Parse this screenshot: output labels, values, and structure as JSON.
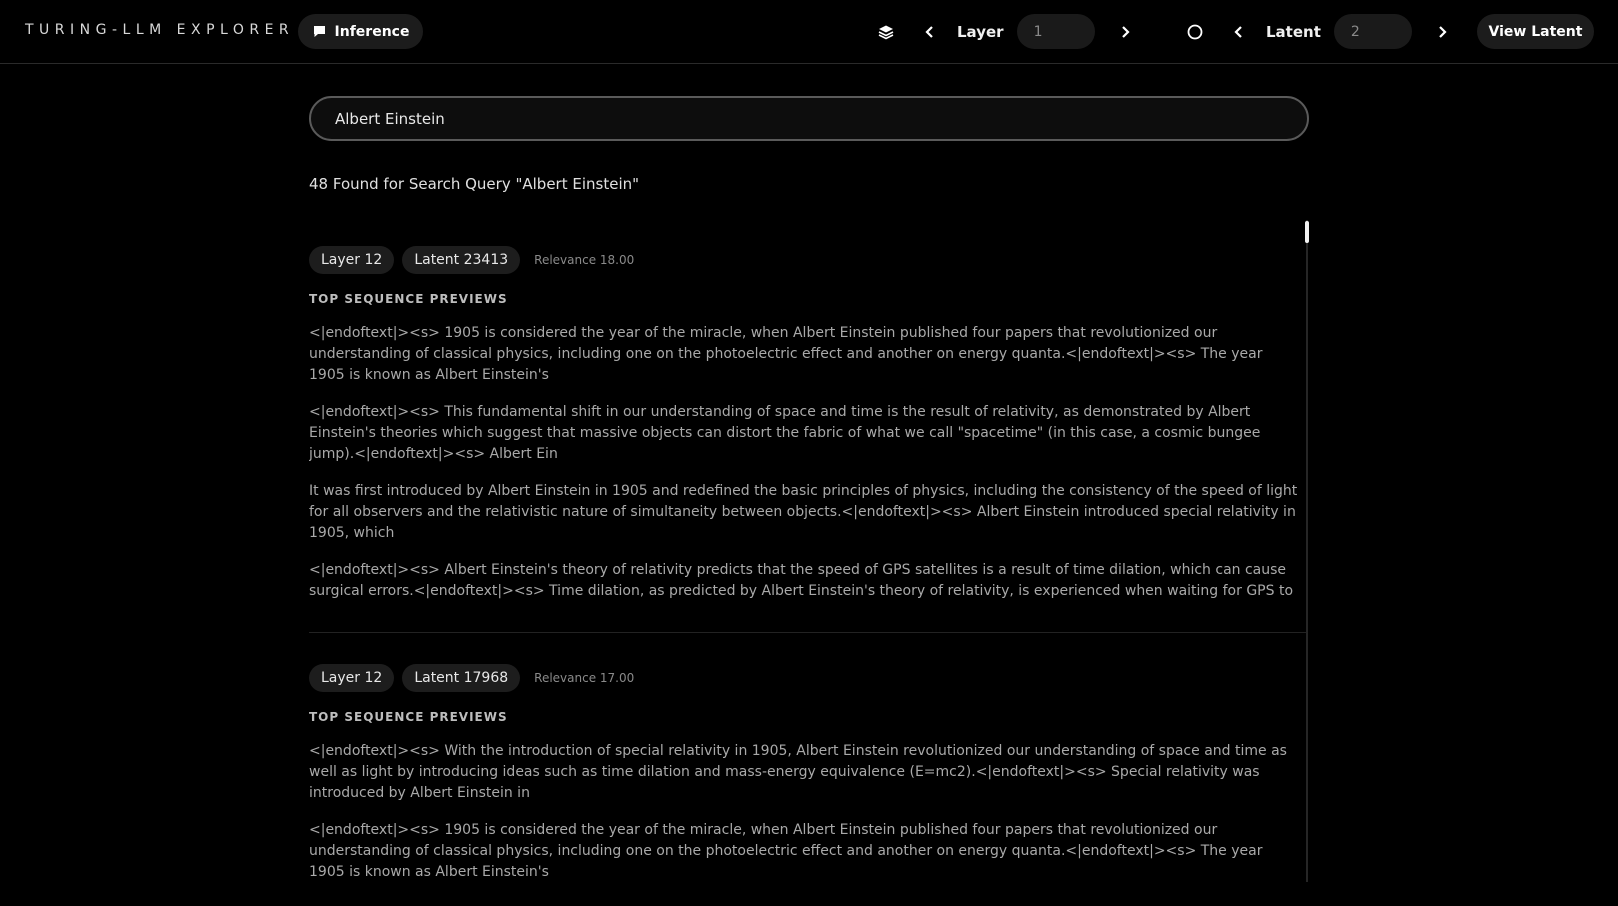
{
  "header": {
    "brand": "TURING-LLM EXPLORER",
    "inference_label": "Inference",
    "layer_label": "Layer",
    "layer_value": "1",
    "latent_label": "Latent",
    "latent_value": "2",
    "view_latent_label": "View Latent"
  },
  "search": {
    "value": "Albert Einstein",
    "result_summary": "48 Found for Search Query \"Albert Einstein\""
  },
  "results": [
    {
      "layer": "Layer 12",
      "latent": "Latent 23413",
      "relevance": "Relevance 18.00",
      "section_title": "TOP SEQUENCE PREVIEWS",
      "sequences": [
        "<|endoftext|><s> 1905 is considered the year of the miracle, when Albert Einstein published four papers that revolutionized our understanding of classical physics, including one on the photoelectric effect and another on energy quanta.<|endoftext|><s> The year 1905 is known as Albert Einstein's",
        "<|endoftext|><s> This fundamental shift in our understanding of space and time is the result of relativity, as demonstrated by Albert Einstein's theories which suggest that massive objects can distort the fabric of what we call \"spacetime\" (in this case, a cosmic bungee jump).<|endoftext|><s> Albert Ein",
        "It was first introduced by Albert Einstein in 1905 and redefined the basic principles of physics, including the consistency of the speed of light for all observers and the relativistic nature of simultaneity between objects.<|endoftext|><s> Albert Einstein introduced special relativity in 1905, which",
        "<|endoftext|><s> Albert Einstein's theory of relativity predicts that the speed of GPS satellites is a result of time dilation, which can cause surgical errors.<|endoftext|><s> Time dilation, as predicted by Albert Einstein's theory of relativity, is experienced when waiting for GPS to"
      ]
    },
    {
      "layer": "Layer 12",
      "latent": "Latent 17968",
      "relevance": "Relevance 17.00",
      "section_title": "TOP SEQUENCE PREVIEWS",
      "sequences": [
        "<|endoftext|><s> With the introduction of special relativity in 1905, Albert Einstein revolutionized our understanding of space and time as well as light by introducing ideas such as time dilation and mass-energy equivalence (E=mc2).<|endoftext|><s> Special relativity was introduced by Albert Einstein in",
        "<|endoftext|><s> 1905 is considered the year of the miracle, when Albert Einstein published four papers that revolutionized our understanding of classical physics, including one on the photoelectric effect and another on energy quanta.<|endoftext|><s> The year 1905 is known as Albert Einstein's"
      ]
    }
  ],
  "icons": {
    "inference": "message-icon",
    "layers": "layers-icon",
    "prev": "chevron-left-icon",
    "next": "chevron-right-icon",
    "circle": "circle-icon"
  }
}
